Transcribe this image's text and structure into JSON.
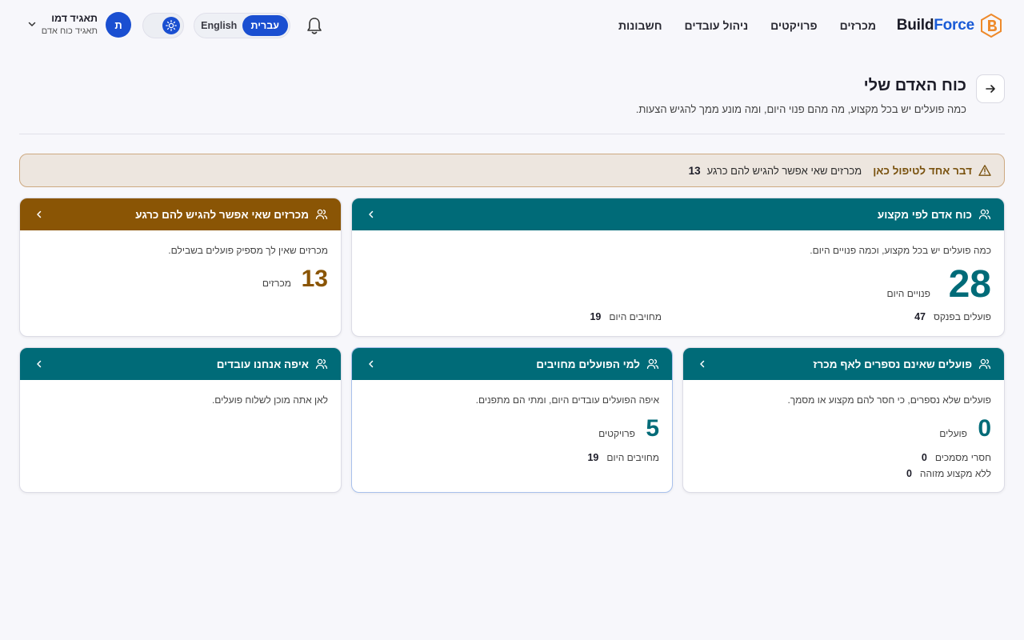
{
  "brand": {
    "name_part1": "Build",
    "name_part2": "Force"
  },
  "nav": [
    {
      "label": "מכרזים"
    },
    {
      "label": "פרויקטים"
    },
    {
      "label": "ניהול עובדים"
    },
    {
      "label": "חשבונות"
    }
  ],
  "language": {
    "english": "English",
    "hebrew": "עברית",
    "active": "hebrew"
  },
  "user": {
    "initial": "ת",
    "name": "תאגיד דמו",
    "role": "תאגיד כוח אדם"
  },
  "page": {
    "title": "כוח האדם שלי",
    "subtitle": "כמה פועלים יש בכל מקצוע, מה מהם פנוי היום, ומה מונע ממך להגיש הצעות."
  },
  "alert": {
    "headline": "דבר אחד לטיפול כאן",
    "text": "מכרזים שאי אפשר להגיש להם כרגע",
    "count": "13"
  },
  "cards": {
    "workforce": {
      "title": "כוח אדם לפי מקצוע",
      "description": "כמה פועלים יש בכל מקצוע, וכמה פנויים היום.",
      "value": "28",
      "unit": "פנויים היום",
      "stat1_label": "פועלים בפנקס",
      "stat1_value": "47",
      "stat2_label": "מחויבים היום",
      "stat2_value": "19"
    },
    "blocked_tenders": {
      "title": "מכרזים שאי אפשר להגיש להם כרגע",
      "description": "מכרזים שאין לך מספיק פועלים בשבילם.",
      "value": "13",
      "unit": "מכרזים"
    },
    "uncounted": {
      "title": "פועלים שאינם נספרים לאף מכרז",
      "description": "פועלים שלא נספרים, כי חסר להם מקצוע או מסמך.",
      "value": "0",
      "unit": "פועלים",
      "stat1_label": "חסרי מסמכים",
      "stat1_value": "0",
      "stat2_label": "ללא מקצוע מזוהה",
      "stat2_value": "0"
    },
    "committed": {
      "title": "למי הפועלים מחויבים",
      "description": "איפה הפועלים עובדים היום, ומתי הם מתפנים.",
      "value": "5",
      "unit": "פרויקטים",
      "stat1_label": "מחויבים היום",
      "stat1_value": "19"
    },
    "locations": {
      "title": "איפה אנחנו עובדים",
      "description": "לאן אתה מוכן לשלוח פועלים."
    }
  },
  "colors": {
    "teal": "#006b78",
    "brown": "#8a5505",
    "accent": "#1a4fd1"
  }
}
